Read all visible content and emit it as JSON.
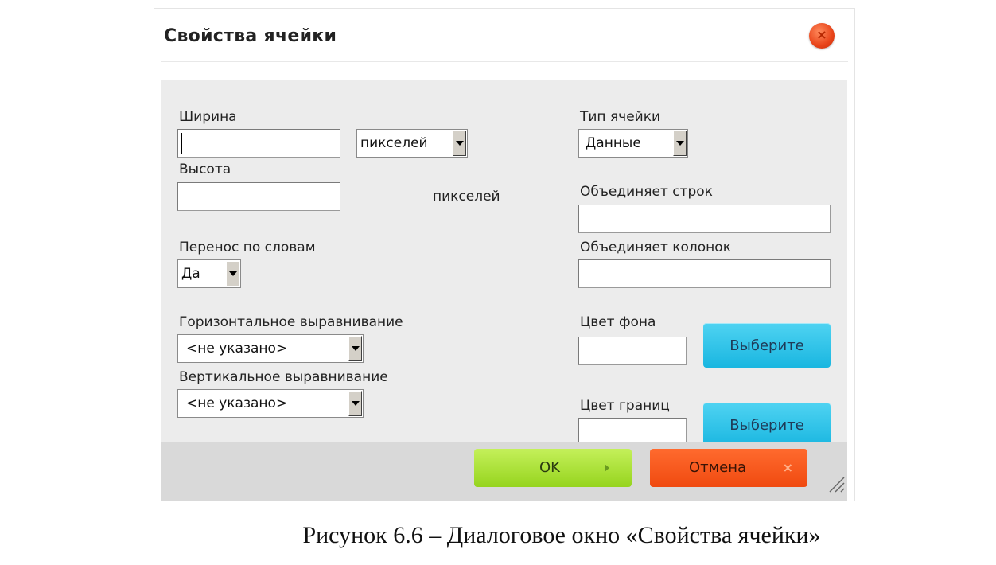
{
  "dialog": {
    "title": "Свойства ячейки",
    "close_icon": "close-icon"
  },
  "fields": {
    "width": {
      "label": "Ширина",
      "value": "",
      "unit_selected": "пикселей"
    },
    "height": {
      "label": "Высота",
      "value": "",
      "unit_text": "пикселей"
    },
    "word_wrap": {
      "label": "Перенос по словам",
      "selected": "Да"
    },
    "horizontal_align": {
      "label": "Горизонтальное выравнивание",
      "selected": "<не указано>"
    },
    "vertical_align": {
      "label": "Вертикальное выравнивание",
      "selected": "<не указано>"
    },
    "cell_type": {
      "label": "Тип ячейки",
      "selected": "Данные"
    },
    "row_span": {
      "label": "Объединяет строк",
      "value": ""
    },
    "col_span": {
      "label": "Объединяет колонок",
      "value": ""
    },
    "bg_color": {
      "label": "Цвет фона",
      "value": "",
      "button": "Выберите"
    },
    "border_color": {
      "label": "Цвет границ",
      "value": "",
      "button": "Выберите"
    }
  },
  "footer": {
    "ok_label": "OK",
    "cancel_label": "Отмена"
  },
  "caption": "Рисунок 6.6 – Диалоговое окно «Свойства ячейки»",
  "colors": {
    "body_bg": "#ececec",
    "footer_bg": "#d9d9d9",
    "choose_button": "#19b6e0",
    "ok_button": "#96d41e",
    "cancel_button": "#f04a10",
    "close_button": "#e8441a"
  }
}
